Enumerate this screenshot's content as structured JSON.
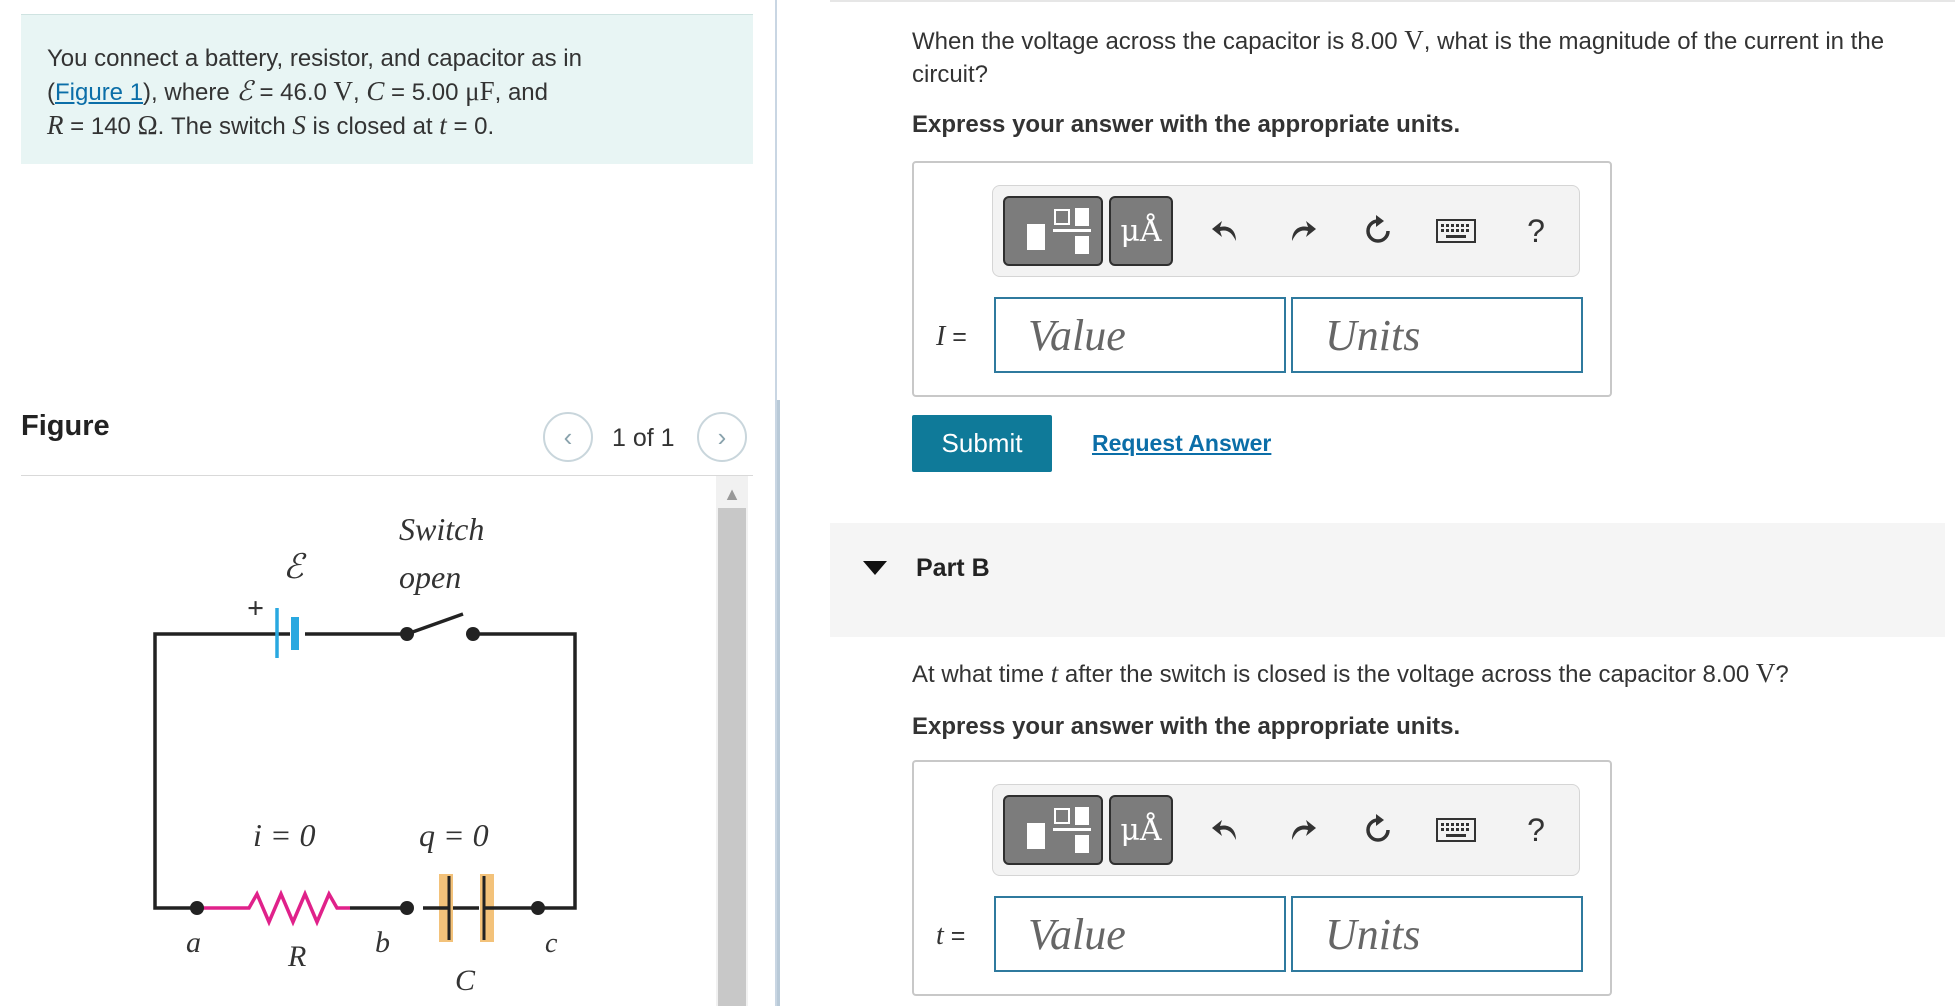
{
  "problem": {
    "intro": "You connect a battery, resistor, and capacitor as in",
    "figure_link": "Figure 1",
    "after_link": "), where ",
    "emf_symbol": "ℰ",
    "emf_value": " = 46.0 ",
    "emf_unit": "V",
    "comma1": ", ",
    "c_symbol": "C",
    "c_value": " = 5.00 ",
    "c_unit": "μF",
    "and_text": ", and",
    "r_symbol": "R",
    "r_value": " = 140 ",
    "r_unit": "Ω",
    "switch_text": ". The switch ",
    "s_symbol": "S",
    "closed_text": " is closed at ",
    "t_symbol": "t",
    "t_value": " = 0."
  },
  "figure": {
    "title": "Figure",
    "prev_icon": "chevron-left-icon",
    "next_icon": "chevron-right-icon",
    "counter": "1 of 1",
    "labels": {
      "emf": "ℰ",
      "plus": "+",
      "switch": "Switch",
      "open": "open",
      "current": "i = 0",
      "charge": "q = 0",
      "a": "a",
      "R": "R",
      "b": "b",
      "C": "C",
      "c": "c"
    },
    "colors": {
      "resistor": "#e0218a",
      "battery": "#29a8e0",
      "capacitor": "#f3c27a"
    }
  },
  "partA": {
    "question_pre": "When the voltage across the capacitor is 8.00 ",
    "question_unit": "V",
    "question_post": ", what is the magnitude of the current in the circuit?",
    "instruction": "Express your answer with the appropriate units.",
    "variable": "I",
    "equals": " =",
    "value_placeholder": "Value",
    "units_placeholder": "Units",
    "units_button": "μÅ",
    "help": "?",
    "submit": "Submit",
    "request_answer": "Request Answer"
  },
  "partB": {
    "title": "Part B",
    "question_pre": "At what time ",
    "question_var": "t",
    "question_mid": " after the switch is closed is the voltage across the capacitor 8.00 ",
    "question_unit": "V",
    "question_post": "?",
    "instruction": "Express your answer with the appropriate units.",
    "variable": "t",
    "equals": " =",
    "value_placeholder": "Value",
    "units_placeholder": "Units",
    "units_button": "μÅ",
    "help": "?"
  },
  "toolbar_icons": [
    "fraction-template-icon",
    "units-icon",
    "undo-icon",
    "redo-icon",
    "reset-icon",
    "keyboard-icon",
    "help-icon"
  ]
}
